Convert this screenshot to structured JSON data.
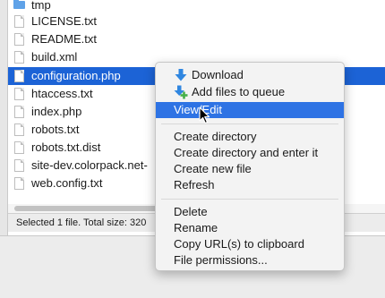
{
  "files": [
    {
      "name": "tmp",
      "type": "folder",
      "selected": false
    },
    {
      "name": "LICENSE.txt",
      "type": "file",
      "selected": false
    },
    {
      "name": "README.txt",
      "type": "file",
      "selected": false
    },
    {
      "name": "build.xml",
      "type": "file",
      "selected": false
    },
    {
      "name": "configuration.php",
      "type": "file",
      "selected": true
    },
    {
      "name": "htaccess.txt",
      "type": "file",
      "selected": false
    },
    {
      "name": "index.php",
      "type": "file",
      "selected": false
    },
    {
      "name": "robots.txt",
      "type": "file",
      "selected": false
    },
    {
      "name": "robots.txt.dist",
      "type": "file",
      "selected": false
    },
    {
      "name": "site-dev.colorpack.net-",
      "type": "file",
      "selected": false
    },
    {
      "name": "web.config.txt",
      "type": "file",
      "selected": false
    }
  ],
  "status": {
    "text": "Selected 1 file. Total size: 320"
  },
  "context_menu": {
    "download": "Download",
    "add_to_queue": "Add files to queue",
    "view_edit": "View/Edit",
    "create_directory": "Create directory",
    "create_directory_enter": "Create directory and enter it",
    "create_new_file": "Create new file",
    "refresh": "Refresh",
    "delete": "Delete",
    "rename": "Rename",
    "copy_urls": "Copy URL(s) to clipboard",
    "file_permissions": "File permissions..."
  },
  "colors": {
    "selection": "#1c63d6",
    "menu_highlight": "#2e73e4",
    "download_icon": "#2f86e0",
    "queue_icon": "#46b04a"
  },
  "icons": {
    "download": "download-arrow-icon",
    "add_to_queue": "add-to-queue-icon",
    "cursor": "mouse-pointer-icon"
  }
}
